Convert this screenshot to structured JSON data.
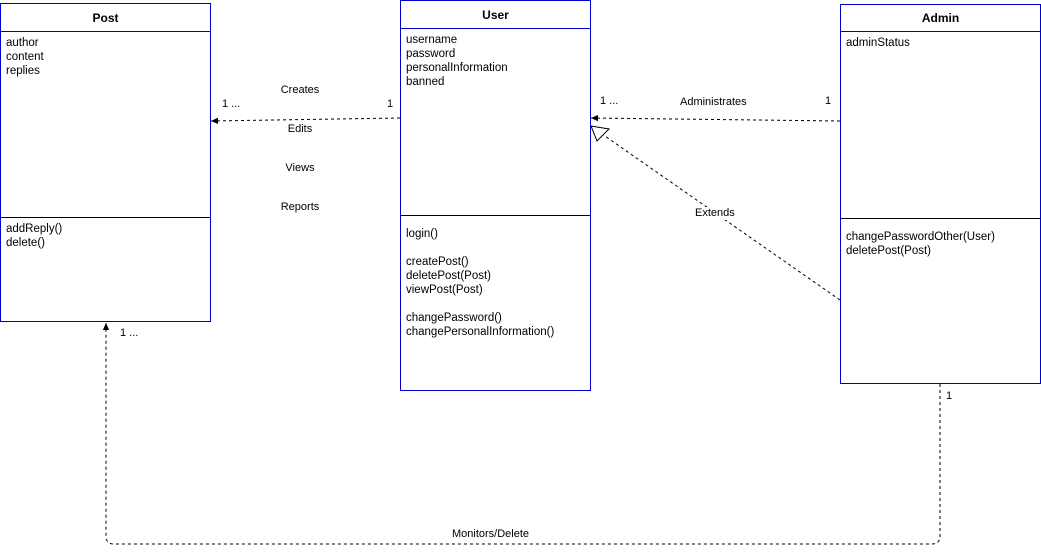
{
  "classes": {
    "post": {
      "name": "Post",
      "attributes": [
        "author",
        "content",
        "replies"
      ],
      "methods": [
        "addReply()",
        "delete()"
      ]
    },
    "user": {
      "name": "User",
      "attributes": [
        "username",
        "password",
        "personalInformation",
        "banned"
      ],
      "methods": [
        "login()",
        "",
        "createPost()",
        "deletePost(Post)",
        "viewPost(Post)",
        "",
        "changePassword()",
        "changePersonalInformation()"
      ]
    },
    "admin": {
      "name": "Admin",
      "attributes": [
        "adminStatus"
      ],
      "methods": [
        "changePasswordOther(User)",
        "deletePost(Post)"
      ]
    }
  },
  "associations": {
    "user_post": {
      "labels": [
        "Creates",
        "Edits",
        "Views",
        "Reports"
      ],
      "source_multiplicity": "1",
      "target_multiplicity": "1 ..."
    },
    "admin_user": {
      "label": "Administrates",
      "source_multiplicity": "1",
      "target_multiplicity": "1 ..."
    },
    "admin_user_inheritance": {
      "label": "Extends"
    },
    "admin_post": {
      "label": "Monitors/Delete",
      "source_multiplicity": "1",
      "target_multiplicity": "1 ..."
    }
  },
  "colors": {
    "class_border": "#0000cc",
    "divider": "#000000",
    "connector": "#000000",
    "background": "#ffffff"
  }
}
